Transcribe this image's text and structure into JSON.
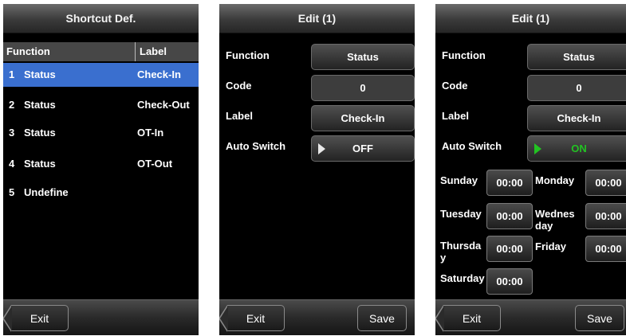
{
  "screen1": {
    "title": "Shortcut Def.",
    "headers": {
      "function": "Function",
      "label": "Label"
    },
    "rows": [
      {
        "num": "1",
        "function": "Status",
        "label": "Check-In"
      },
      {
        "num": "2",
        "function": "Status",
        "label": "Check-Out"
      },
      {
        "num": "3",
        "function": "Status",
        "label": "OT-In"
      },
      {
        "num": "4",
        "function": "Status",
        "label": "OT-Out"
      },
      {
        "num": "5",
        "function": "Undefine",
        "label": ""
      }
    ],
    "exit_label": "Exit"
  },
  "screen2": {
    "title": "Edit (1)",
    "fields": {
      "function_label": "Function",
      "function_value": "Status",
      "code_label": "Code",
      "code_value": "0",
      "label_label": "Label",
      "label_value": "Check-In",
      "auto_label": "Auto Switch",
      "auto_value": "OFF"
    },
    "exit_label": "Exit",
    "save_label": "Save"
  },
  "screen3": {
    "title": "Edit (1)",
    "fields": {
      "function_label": "Function",
      "function_value": "Status",
      "code_label": "Code",
      "code_value": "0",
      "label_label": "Label",
      "label_value": "Check-In",
      "auto_label": "Auto Switch",
      "auto_value": "ON"
    },
    "days": {
      "sunday": {
        "label": "Sunday",
        "time": "00:00"
      },
      "monday": {
        "label": "Monday",
        "time": "00:00"
      },
      "tuesday": {
        "label": "Tuesday",
        "time": "00:00"
      },
      "wednesday": {
        "label_line1": "Wednes",
        "label_line2": "day",
        "time": "00:00"
      },
      "thursday": {
        "label_line1": "Thursda",
        "label_line2": "y",
        "time": "00:00"
      },
      "friday": {
        "label": "Friday",
        "time": "00:00"
      },
      "saturday": {
        "label": "Saturday",
        "time": "00:00"
      }
    },
    "exit_label": "Exit",
    "save_label": "Save"
  },
  "colors": {
    "selection": "#3a6fcf",
    "on_green": "#22c322"
  }
}
